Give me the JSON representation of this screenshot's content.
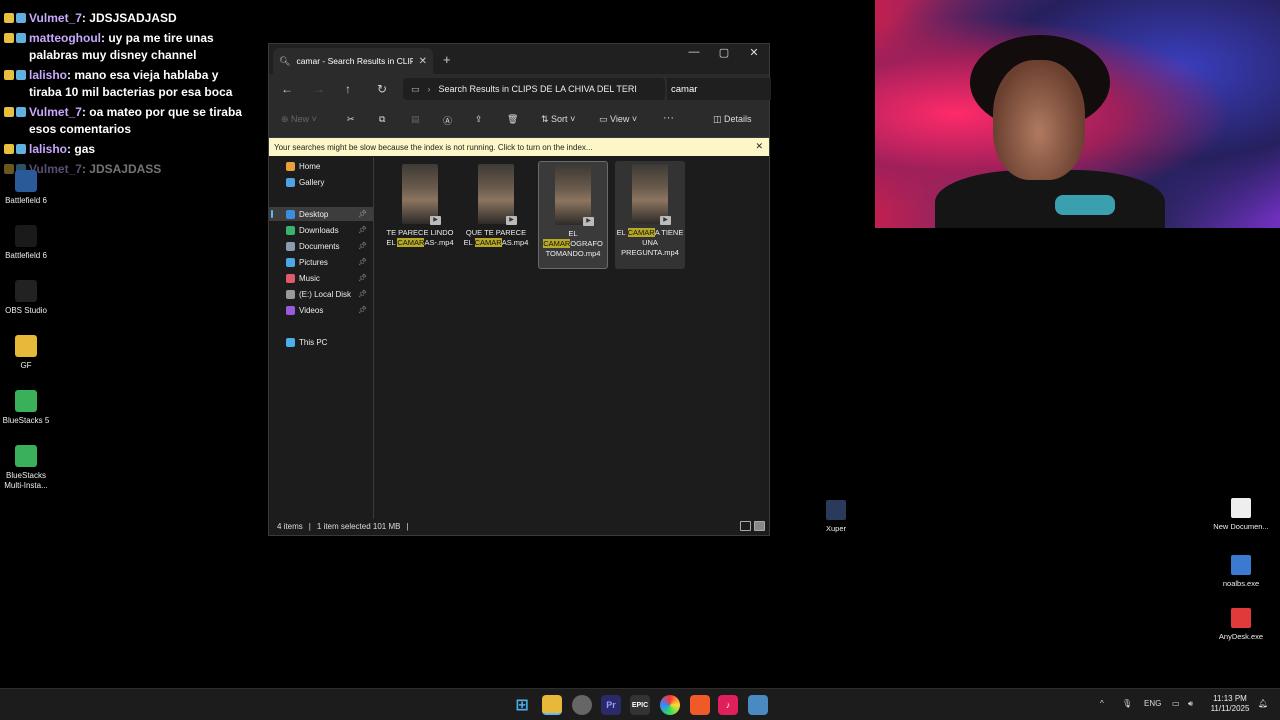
{
  "chat": {
    "messages": [
      {
        "user": "Vulmet_7",
        "text": "JDSJSADJASD",
        "faded": false
      },
      {
        "user": "matteoghoul",
        "text": "uy pa me tire unas palabras muy disney channel",
        "faded": false
      },
      {
        "user": "lalisho",
        "text": "mano esa vieja hablaba y tiraba 10 mil bacterias por esa boca",
        "faded": false
      },
      {
        "user": "Vulmet_7",
        "text": "oa mateo por que se tiraba esos comentarios",
        "faded": false
      },
      {
        "user": "lalisho",
        "text": "gas",
        "faded": false
      },
      {
        "user": "Vulmet_7",
        "text": "JDSAJDASS",
        "faded": true
      }
    ]
  },
  "desktop_left": [
    {
      "label": "Battlefield 6",
      "icon": "game-icon"
    },
    {
      "label": "Battlefield 6",
      "icon": "bf-icon"
    },
    {
      "label": "OBS Studio",
      "icon": "obs-icon"
    },
    {
      "label": "GF",
      "icon": "folder-icon"
    },
    {
      "label": "BlueStacks 5",
      "icon": "bluestacks-icon"
    },
    {
      "label": "BlueStacks Multi-Insta...",
      "icon": "bluestacks-multi-icon"
    }
  ],
  "explorer": {
    "tab_title": "camar - Search Results in CLIP",
    "path_label": "Search Results in CLIPS DE LA CHIVA DEL TERI",
    "search_value": "camar",
    "toolbar": {
      "new": "New",
      "sort": "Sort",
      "view": "View",
      "details": "Details",
      "more": "···"
    },
    "warning": "Your searches might be slow because the index is not running.  Click to turn on the index...",
    "nav": [
      {
        "label": "Home",
        "color": "#e8a13a",
        "pinned": false
      },
      {
        "label": "Gallery",
        "color": "#4fa3e0",
        "pinned": false
      },
      {
        "label": "Desktop",
        "color": "#3a8ee0",
        "pinned": true,
        "selected": true
      },
      {
        "label": "Downloads",
        "color": "#38b36b",
        "pinned": true
      },
      {
        "label": "Documents",
        "color": "#8a9ab0",
        "pinned": true
      },
      {
        "label": "Pictures",
        "color": "#4aa8e8",
        "pinned": true
      },
      {
        "label": "Music",
        "color": "#e05a6a",
        "pinned": true
      },
      {
        "label": "(E:) Local Disk",
        "color": "#999999",
        "pinned": true
      },
      {
        "label": "Videos",
        "color": "#9a5ae0",
        "pinned": true
      },
      {
        "label": "This PC",
        "color": "#4ab0e8",
        "pinned": false
      }
    ],
    "files": [
      {
        "before": "TE PARECE LINDO EL ",
        "match": "CAMAR",
        "after": "AS-.mp4",
        "state": "normal"
      },
      {
        "before": "QUE TE PARECE EL ",
        "match": "CAMAR",
        "after": "AS.mp4",
        "state": "normal"
      },
      {
        "before": "EL ",
        "match": "CAMAR",
        "after": "OGRAFO TOMANDO.mp4",
        "state": "selected"
      },
      {
        "before": "EL ",
        "match": "CAMAR",
        "after": "A TIENE UNA PREGUNTA.mp4",
        "state": "hover"
      }
    ],
    "status": {
      "count": "4 items",
      "selected": "1 item selected  101 MB"
    }
  },
  "desktop_right": [
    {
      "label": "Xuper",
      "icon": "xuper-icon"
    },
    {
      "label": "New Documen...",
      "icon": "document-icon"
    },
    {
      "label": "noalbs.exe",
      "icon": "exe-icon"
    },
    {
      "label": "AnyDesk.exe",
      "icon": "anydesk-icon"
    }
  ],
  "taskbar": {
    "apps": [
      "start",
      "file-explorer",
      "chrome",
      "premiere",
      "epic",
      "color-app",
      "brave",
      "tiktok",
      "calculator"
    ],
    "language": "ENG",
    "time": "11:13 PM",
    "date": "11/11/2025"
  }
}
